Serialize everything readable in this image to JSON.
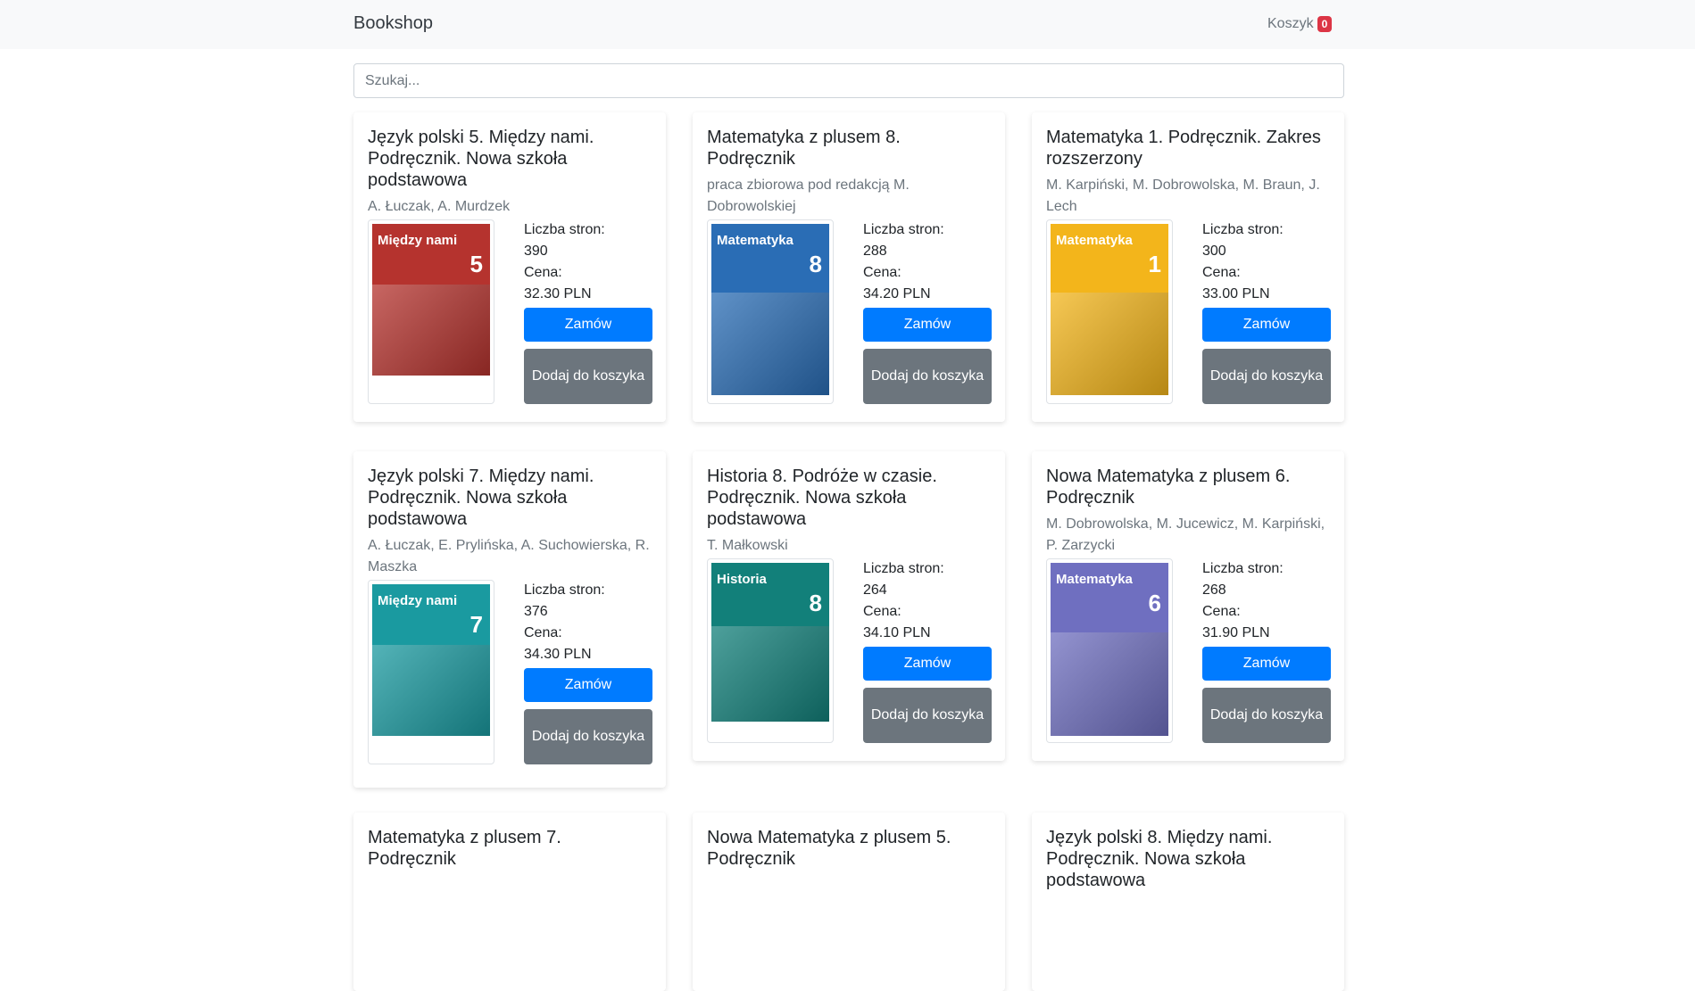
{
  "navbar": {
    "brand": "Bookshop",
    "cart_label": "Koszyk",
    "cart_count": "0"
  },
  "search": {
    "placeholder": "Szukaj..."
  },
  "labels": {
    "pages": "Liczba stron:",
    "price": "Cena:",
    "order": "Zamów",
    "add_to_cart": "Dodaj do koszyka"
  },
  "books": [
    {
      "title": "Język polski 5. Między nami. Podręcznik. Nowa szkoła podstawowa",
      "authors": "A. Łuczak, A. Murdzek",
      "pages": "390",
      "price": "32.30 PLN",
      "cover_text": "Między nami",
      "cover_num": "5",
      "cover_color": "#b5332e"
    },
    {
      "title": "Matematyka z plusem 8. Podręcznik",
      "authors": "praca zbiorowa pod redakcją M. Dobrowolskiej",
      "pages": "288",
      "price": "34.20 PLN",
      "cover_text": "Matematyka",
      "cover_num": "8",
      "cover_color": "#2a6db5"
    },
    {
      "title": "Matematyka 1. Podręcznik. Zakres rozszerzony",
      "authors": "M. Karpiński, M. Dobrowolska, M. Braun, J. Lech",
      "pages": "300",
      "price": "33.00 PLN",
      "cover_text": "Matematyka",
      "cover_num": "1",
      "cover_color": "#f3b51b"
    },
    {
      "title": "Język polski 7. Między nami. Podręcznik. Nowa szkoła podstawowa",
      "authors": "A. Łuczak, E. Prylińska, A. Suchowierska, R. Maszka",
      "pages": "376",
      "price": "34.30 PLN",
      "cover_text": "Między nami",
      "cover_num": "7",
      "cover_color": "#1a9aa0"
    },
    {
      "title": "Historia 8. Podróże w czasie. Podręcznik. Nowa szkoła podstawowa",
      "authors": "T. Małkowski",
      "pages": "264",
      "price": "34.10 PLN",
      "cover_text": "Historia",
      "cover_num": "8",
      "cover_color": "#12807a"
    },
    {
      "title": "Nowa Matematyka z plusem 6. Podręcznik",
      "authors": "M. Dobrowolska, M. Jucewicz, M. Karpiński, P. Zarzycki",
      "pages": "268",
      "price": "31.90 PLN",
      "cover_text": "Matematyka",
      "cover_num": "6",
      "cover_color": "#6f6fc0"
    },
    {
      "title": "Matematyka z plusem 7. Podręcznik",
      "authors": "",
      "pages": "",
      "price": ""
    },
    {
      "title": "Nowa Matematyka z plusem 5. Podręcznik",
      "authors": "",
      "pages": "",
      "price": ""
    },
    {
      "title": "Język polski 8. Między nami. Podręcznik. Nowa szkoła podstawowa",
      "authors": "",
      "pages": "",
      "price": ""
    }
  ]
}
